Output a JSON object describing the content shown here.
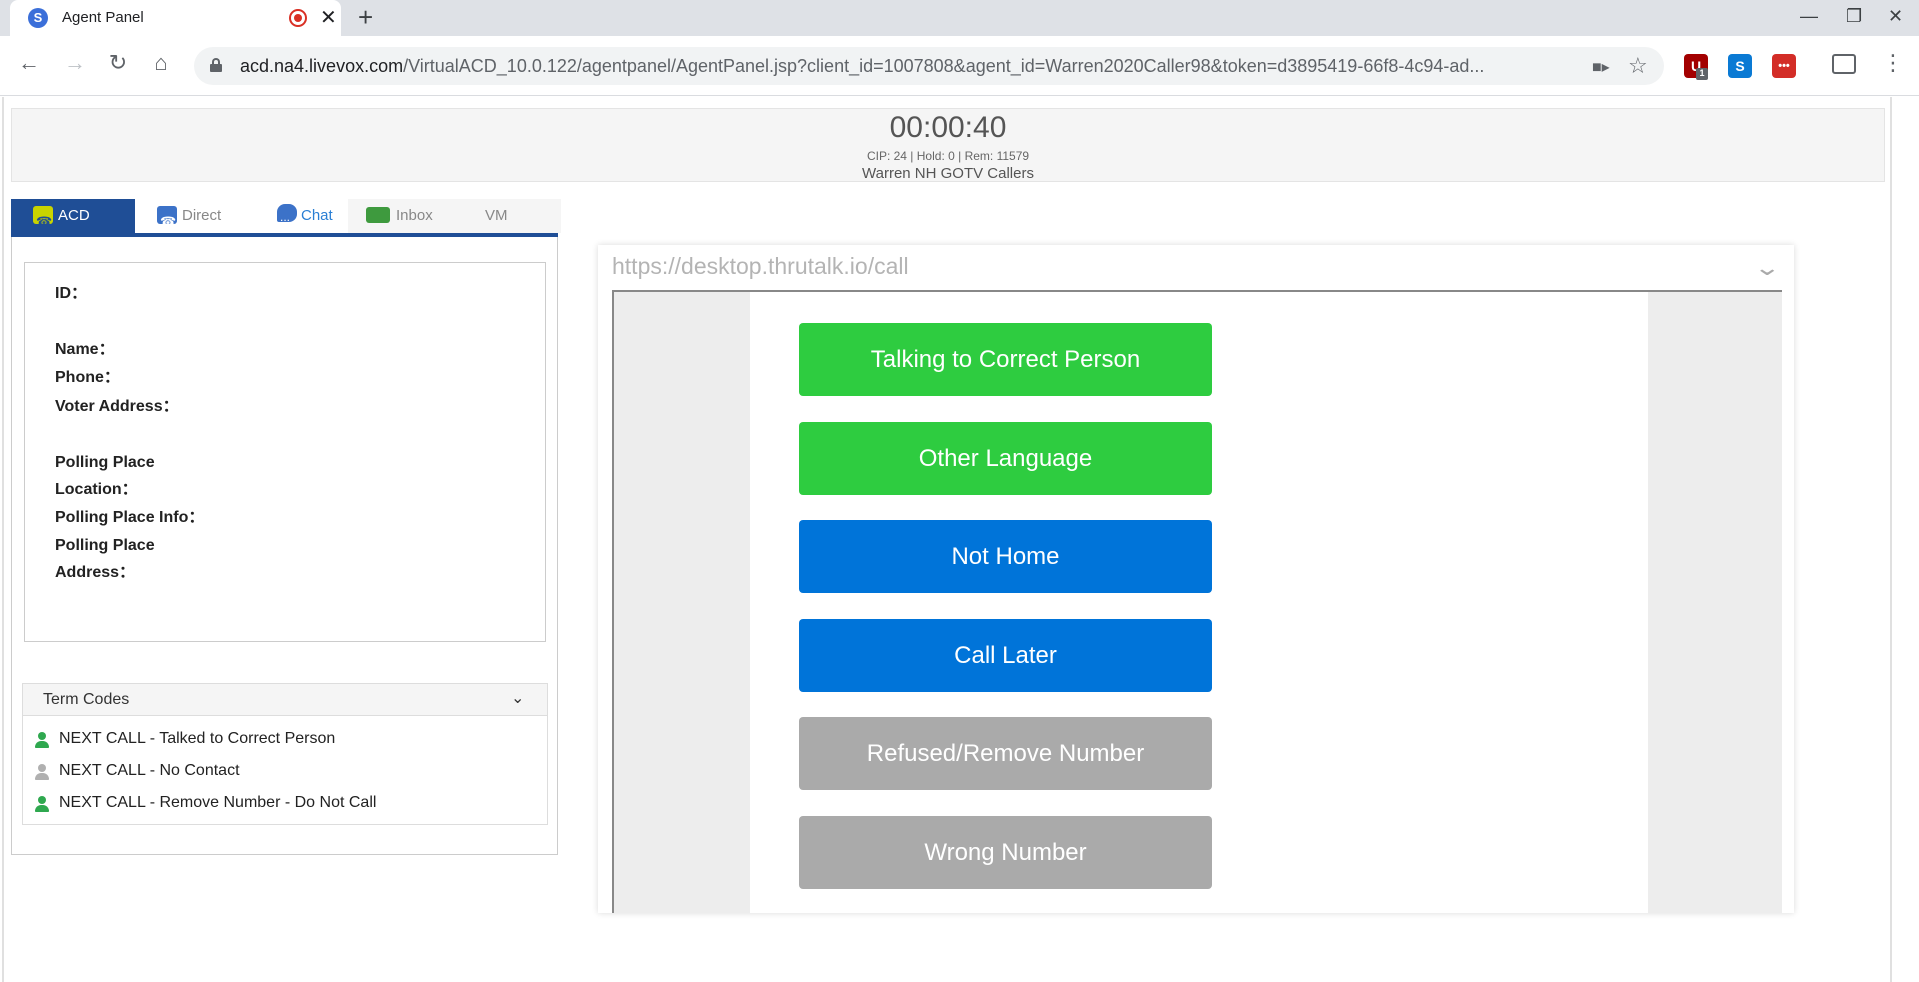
{
  "browser": {
    "tab_title": "Agent Panel",
    "new_tab_symbol": "+",
    "close_symbol": "✕",
    "url_host": "acd.na4.livevox.com",
    "url_path": "/VirtualACD_10.0.122/agentpanel/AgentPanel.jsp?client_id=1007808&agent_id=Warren2020Caller98&token=d3895419-66f8-4c94-ad...",
    "extension_badge": "1",
    "icons": [
      "back-icon",
      "forward-icon",
      "reload-icon",
      "home-icon",
      "lock-icon",
      "camera-icon",
      "star-icon",
      "ublock-icon",
      "skype-icon",
      "lastpass-icon",
      "cast-icon",
      "menu-icon"
    ]
  },
  "header": {
    "timer": "00:00:40",
    "stats": "CIP: 24 | Hold: 0 | Rem: 11579",
    "campaign": "Warren NH GOTV Callers"
  },
  "agent_tabs": [
    {
      "label": "ACD"
    },
    {
      "label": "Direct"
    },
    {
      "label": "Chat"
    },
    {
      "label": "Inbox"
    },
    {
      "label": "VM"
    }
  ],
  "info": {
    "id_label": "ID：",
    "name_label": "Name：",
    "phone_label": "Phone：",
    "voter_address_label": "Voter Address：",
    "polling_place_location_label_1": "Polling Place",
    "polling_place_location_label_2": "Location：",
    "polling_place_info_label": "Polling Place Info：",
    "polling_place_address_label_1": "Polling Place",
    "polling_place_address_label_2": "Address："
  },
  "term_codes": {
    "title": "Term Codes",
    "items": [
      {
        "label": "NEXT CALL - Talked to Correct Person",
        "color": "#2fa84f"
      },
      {
        "label": "NEXT CALL - No Contact",
        "color": "#b0b0b0"
      },
      {
        "label": "NEXT CALL - Remove Number - Do Not Call",
        "color": "#2fa84f"
      }
    ]
  },
  "frame": {
    "url": "https://desktop.thrutalk.io/call",
    "buttons": [
      {
        "label": "Talking to Correct Person",
        "color": "#2ecc40"
      },
      {
        "label": "Other Language",
        "color": "#2ecc40"
      },
      {
        "label": "Not Home",
        "color": "#0074d9"
      },
      {
        "label": "Call Later",
        "color": "#0074d9"
      },
      {
        "label": "Refused/Remove Number",
        "color": "#aaaaaa"
      },
      {
        "label": "Wrong Number",
        "color": "#aaaaaa"
      }
    ]
  }
}
